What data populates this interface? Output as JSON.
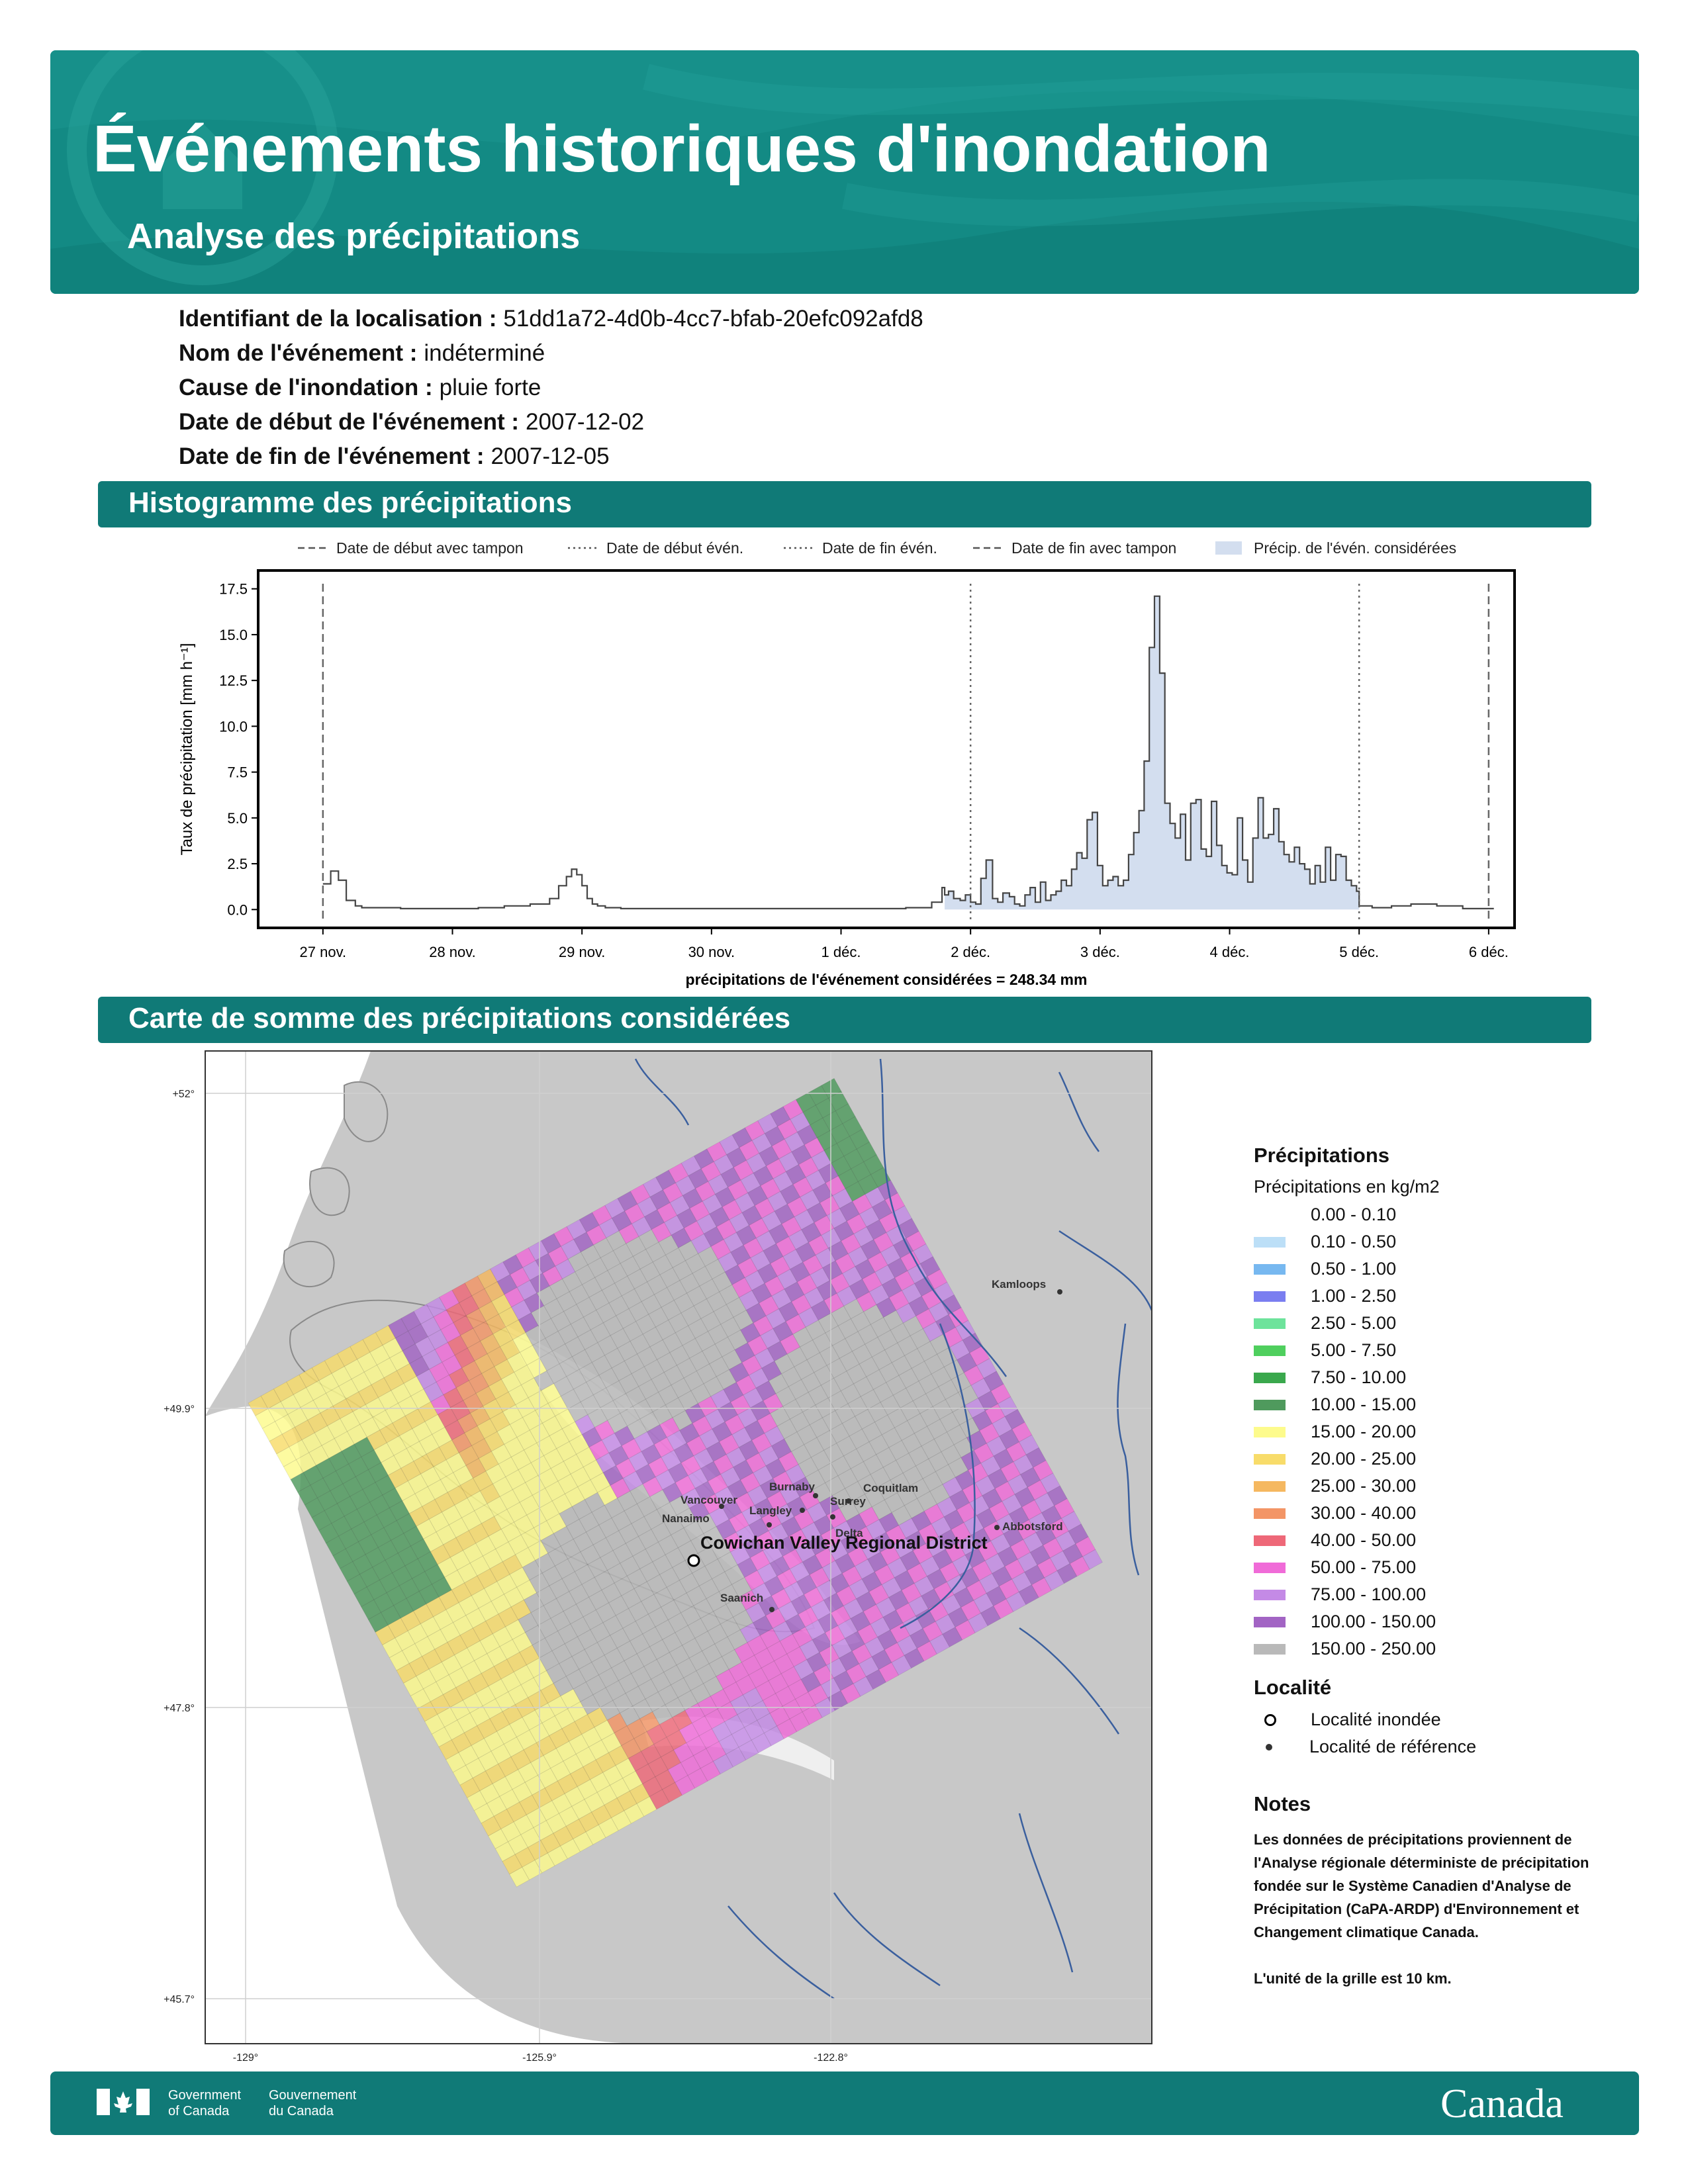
{
  "header": {
    "title": "Événements historiques d'inondation",
    "subtitle": "Analyse des précipitations"
  },
  "meta": {
    "location_id_label": "Identifiant de la localisation :",
    "location_id": "51dd1a72-4d0b-4cc7-bfab-20efc092afd8",
    "event_name_label": "Nom de l'événement :",
    "event_name": "indéterminé",
    "cause_label": "Cause de l'inondation :",
    "cause": "pluie forte",
    "start_label": "Date de début de l'événement :",
    "start": "2007-12-02",
    "end_label": "Date de fin de l'événement :",
    "end": "2007-12-05"
  },
  "sections": {
    "histogram": "Histogramme des précipitations",
    "map": "Carte de somme des précipitations considérées"
  },
  "chart_data": {
    "type": "area",
    "title": "",
    "ylabel": "Taux de précipitation [mm h⁻¹]",
    "xlabel": "",
    "ylim": [
      -1,
      18.5
    ],
    "xlim": [
      -0.5,
      9.2
    ],
    "yticks": [
      0.0,
      2.5,
      5.0,
      7.5,
      10.0,
      12.5,
      15.0,
      17.5
    ],
    "yticklabels": [
      "0.0",
      "2.5",
      "5.0",
      "7.5",
      "10.0",
      "12.5",
      "15.0",
      "17.5"
    ],
    "xticks": [
      0,
      1,
      2,
      3,
      4,
      5,
      6,
      7,
      8,
      9
    ],
    "xticklabels": [
      "27 nov.",
      "28 nov.",
      "29 nov.",
      "30 nov.",
      "1 déc.",
      "2 déc.",
      "3 déc.",
      "4 déc.",
      "5 déc.",
      "6 déc."
    ],
    "legend": [
      {
        "label": "Date de début avec tampon",
        "style": "dashed"
      },
      {
        "label": "Date de début événement",
        "style": "dotted"
      },
      {
        "label": "Date de fin évén.",
        "style": "dotted"
      },
      {
        "label": "Date de fin avec tampon",
        "style": "dashed"
      },
      {
        "label": "Précip. de l'évén. considérées",
        "style": "fill"
      }
    ],
    "legend_start_label": "Date de début évén.",
    "vlines": [
      {
        "x": 0,
        "style": "dashed"
      },
      {
        "x": 5,
        "style": "dotted"
      },
      {
        "x": 8,
        "style": "dotted"
      },
      {
        "x": 9,
        "style": "dashed"
      }
    ],
    "shaded_range": [
      4.79,
      8.0
    ],
    "total_label": "précipitations de l'événement considérées = 248.34 mm",
    "series": [
      {
        "x": [
          0.0,
          0.06,
          0.12,
          0.18,
          0.25,
          0.3,
          0.4,
          0.6,
          0.8,
          1.0,
          1.2,
          1.4,
          1.6,
          1.75,
          1.82,
          1.88,
          1.92,
          1.96,
          2.0,
          2.04,
          2.08,
          2.12,
          2.18,
          2.3,
          2.6,
          3.0,
          3.5,
          4.0,
          4.5,
          4.7,
          4.78,
          4.8,
          4.83,
          4.87,
          4.92,
          4.96,
          5.0,
          5.04,
          5.08,
          5.12,
          5.17,
          5.21,
          5.25,
          5.3,
          5.34,
          5.38,
          5.42,
          5.46,
          5.5,
          5.54,
          5.58,
          5.62,
          5.66,
          5.7,
          5.74,
          5.78,
          5.82,
          5.86,
          5.9,
          5.94,
          5.98,
          6.02,
          6.06,
          6.1,
          6.14,
          6.18,
          6.22,
          6.26,
          6.3,
          6.34,
          6.38,
          6.42,
          6.46,
          6.5,
          6.54,
          6.58,
          6.62,
          6.66,
          6.7,
          6.74,
          6.78,
          6.82,
          6.86,
          6.9,
          6.94,
          6.98,
          7.02,
          7.06,
          7.1,
          7.14,
          7.18,
          7.22,
          7.26,
          7.3,
          7.34,
          7.38,
          7.42,
          7.46,
          7.5,
          7.54,
          7.58,
          7.62,
          7.66,
          7.7,
          7.74,
          7.78,
          7.82,
          7.86,
          7.9,
          7.94,
          7.98,
          8.0,
          8.1,
          8.25,
          8.4,
          8.6,
          8.8,
          9.0
        ],
        "values": [
          1.4,
          2.1,
          1.6,
          0.5,
          0.2,
          0.1,
          0.1,
          0.05,
          0.05,
          0.05,
          0.1,
          0.2,
          0.3,
          0.6,
          1.3,
          1.8,
          2.2,
          1.9,
          1.3,
          0.6,
          0.3,
          0.2,
          0.1,
          0.05,
          0.05,
          0.05,
          0.05,
          0.05,
          0.1,
          0.4,
          1.2,
          0.8,
          1.0,
          0.6,
          0.5,
          0.8,
          0.4,
          0.3,
          1.7,
          2.7,
          0.6,
          0.4,
          0.9,
          0.7,
          0.3,
          0.2,
          0.8,
          1.2,
          0.4,
          1.5,
          0.5,
          0.8,
          1.0,
          1.6,
          1.3,
          2.2,
          3.1,
          2.8,
          4.9,
          5.3,
          2.4,
          1.3,
          1.6,
          1.8,
          1.3,
          1.6,
          3.0,
          4.2,
          5.4,
          8.1,
          14.3,
          17.1,
          12.9,
          5.8,
          4.7,
          3.9,
          5.2,
          2.7,
          5.8,
          6.0,
          3.3,
          2.9,
          5.9,
          3.5,
          2.4,
          2.0,
          1.9,
          5.0,
          2.7,
          1.5,
          3.9,
          6.1,
          3.9,
          4.1,
          5.5,
          3.7,
          3.0,
          2.6,
          3.4,
          2.5,
          2.2,
          1.4,
          2.4,
          1.5,
          3.4,
          1.6,
          3.0,
          2.9,
          1.6,
          1.3,
          1.0,
          0.2,
          0.1,
          0.2,
          0.3,
          0.2,
          0.05,
          0.05
        ]
      }
    ]
  },
  "map": {
    "lat_labels": [
      "+52°",
      "+49.9°",
      "+47.8°",
      "+45.7°"
    ],
    "lon_labels": [
      "-129°",
      "-125.9°",
      "-122.8°"
    ],
    "places": {
      "kamloops": "Kamloops",
      "burnaby": "Burnaby",
      "coquitlam": "Coquitlam",
      "vancouver": "Vancouver",
      "surrey": "Surrey",
      "langley": "Langley",
      "nanaimo": "Nanaimo",
      "delta": "Delta",
      "abbotsford": "Abbotsford",
      "saanich": "Saanich",
      "main": "Cowichan Valley Regional District"
    },
    "colors": {
      "water": "#ffffff",
      "land": "#c8c8c8",
      "river": "#3a5f9e"
    }
  },
  "legend": {
    "title": "Précipitations",
    "subtitle": "Précipitations en kg/m2",
    "items": [
      {
        "label": "0.00 - 0.10",
        "color": "#ffffff"
      },
      {
        "label": "0.10 - 0.50",
        "color": "#bcdff7"
      },
      {
        "label": "0.50 - 1.00",
        "color": "#77b8f0"
      },
      {
        "label": "1.00 - 2.50",
        "color": "#7a7ef0"
      },
      {
        "label": "2.50 - 5.00",
        "color": "#6de39b"
      },
      {
        "label": "5.00 - 7.50",
        "color": "#4fcf5e"
      },
      {
        "label": "7.50 - 10.00",
        "color": "#3aa84d"
      },
      {
        "label": "10.00 - 15.00",
        "color": "#4f9a5d"
      },
      {
        "label": "15.00 - 20.00",
        "color": "#fdfb8c"
      },
      {
        "label": "20.00 - 25.00",
        "color": "#f8dc6a"
      },
      {
        "label": "25.00 - 30.00",
        "color": "#f5b860"
      },
      {
        "label": "30.00 - 40.00",
        "color": "#f39566"
      },
      {
        "label": "40.00 - 50.00",
        "color": "#ee6878"
      },
      {
        "label": "50.00 - 75.00",
        "color": "#f06bd8"
      },
      {
        "label": "75.00 - 100.00",
        "color": "#c48ae6"
      },
      {
        "label": "100.00 - 150.00",
        "color": "#a264c4"
      },
      {
        "label": "150.00 - 250.00",
        "color": "#b9b9b9"
      }
    ],
    "locality_title": "Localité",
    "flooded": "Localité inondée",
    "reference": "Localité de référence",
    "notes_title": "Notes",
    "notes_text": "Les données de précipitations proviennent de l'Analyse régionale déterministe de précipitation fondée sur le Système Canadien d'Analyse de Précipitation (CaPA-ARDP) d'Environnement et Changement climatique Canada.",
    "grid_note": "L'unité de la grille est 10 km."
  },
  "footer": {
    "gov_en_1": "Government",
    "gov_en_2": "of Canada",
    "gov_fr_1": "Gouvernement",
    "gov_fr_2": "du Canada",
    "wordmark": "Canada"
  }
}
